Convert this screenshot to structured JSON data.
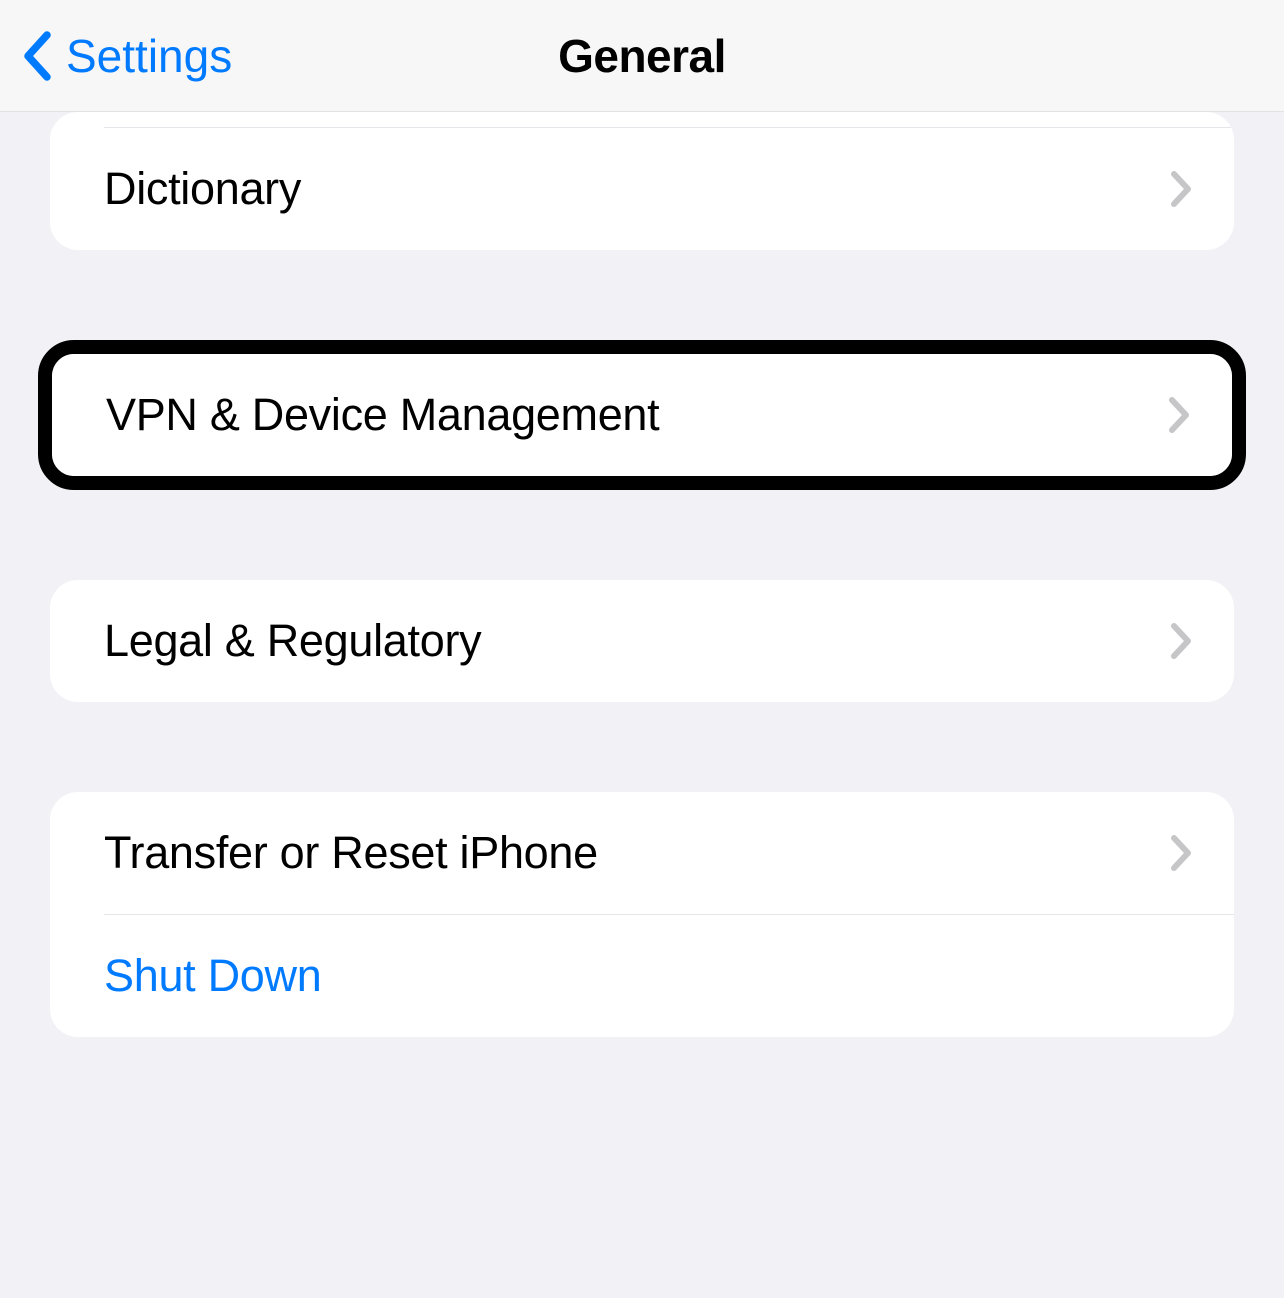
{
  "nav": {
    "back_label": "Settings",
    "title": "General"
  },
  "groups": {
    "g1": {
      "dictionary": "Dictionary"
    },
    "g2": {
      "vpn": "VPN & Device Management"
    },
    "g3": {
      "legal": "Legal & Regulatory"
    },
    "g4": {
      "transfer": "Transfer or Reset iPhone",
      "shutdown": "Shut Down"
    }
  }
}
